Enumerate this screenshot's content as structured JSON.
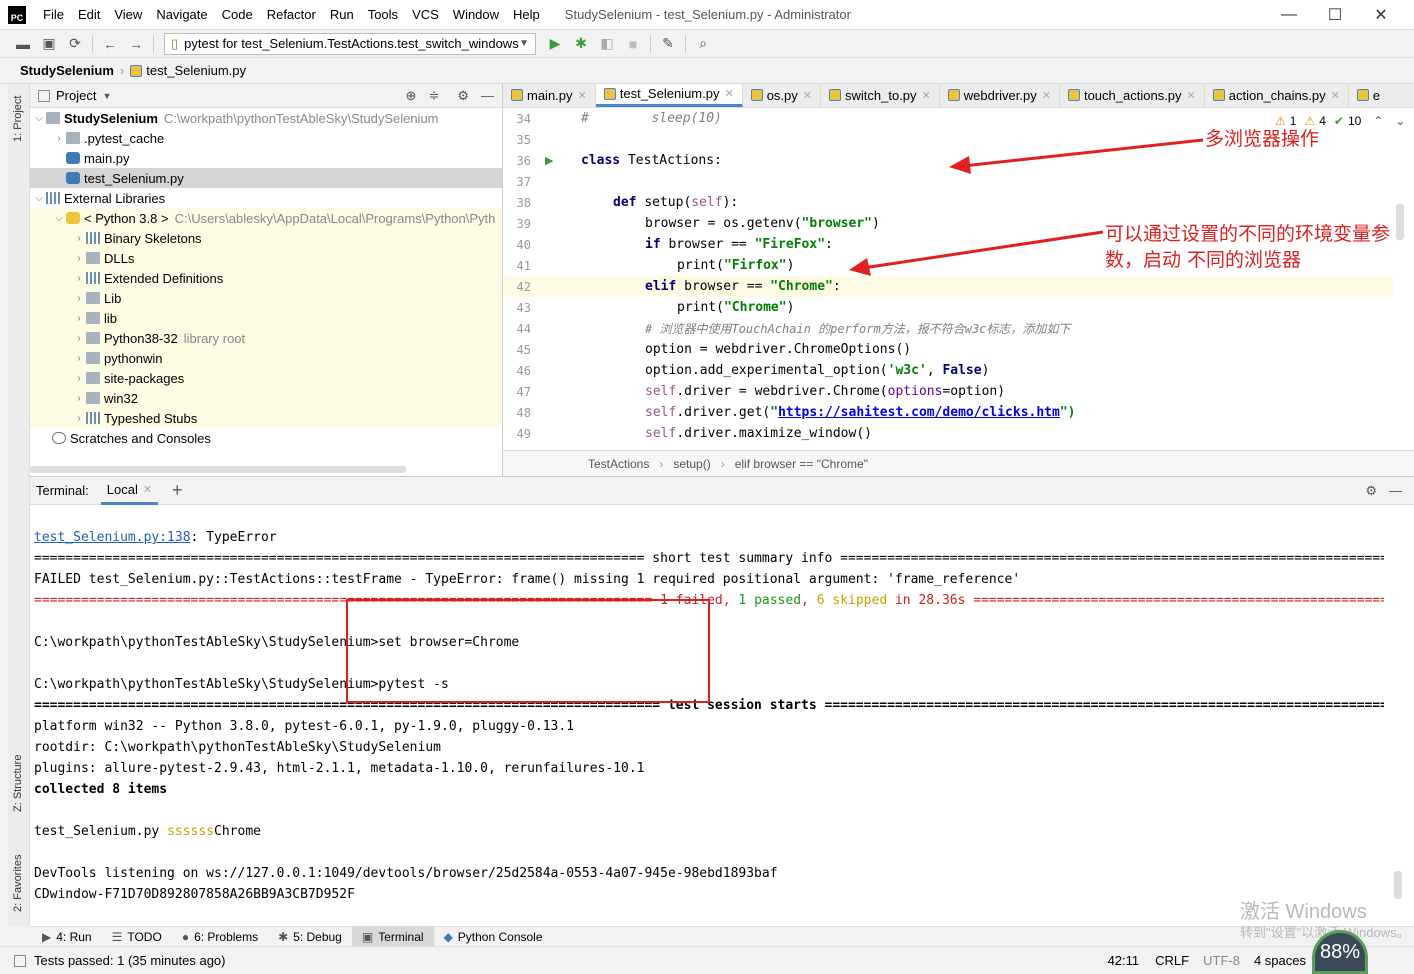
{
  "titlebar": {
    "menus": [
      "File",
      "Edit",
      "View",
      "Navigate",
      "Code",
      "Refactor",
      "Run",
      "Tools",
      "VCS",
      "Window",
      "Help"
    ],
    "window_title": "StudySelenium - test_Selenium.py - Administrator",
    "logo": "PC"
  },
  "toolbar": {
    "run_config": "pytest for test_Selenium.TestActions.test_switch_windows"
  },
  "breadcrumb": {
    "project": "StudySelenium",
    "file": "test_Selenium.py"
  },
  "left_strip": {
    "project_tab": "1: Project",
    "structure_tab": "Z: Structure",
    "favorites_tab": "2: Favorites"
  },
  "project": {
    "header": "Project",
    "tree": [
      {
        "label": "StudySelenium",
        "hint": "C:\\workpath\\pythonTestAbleSky\\StudySelenium"
      },
      {
        "label": ".pytest_cache",
        "hint": ""
      },
      {
        "label": "main.py",
        "hint": ""
      },
      {
        "label": "test_Selenium.py",
        "hint": ""
      },
      {
        "label": "External Libraries",
        "hint": ""
      },
      {
        "label": "< Python 3.8 >",
        "hint": "C:\\Users\\ablesky\\AppData\\Local\\Programs\\Python\\Pyth"
      },
      {
        "label": "Binary Skeletons",
        "hint": ""
      },
      {
        "label": "DLLs",
        "hint": ""
      },
      {
        "label": "Extended Definitions",
        "hint": ""
      },
      {
        "label": "Lib",
        "hint": ""
      },
      {
        "label": "lib",
        "hint": ""
      },
      {
        "label": "Python38-32",
        "hint": "library root"
      },
      {
        "label": "pythonwin",
        "hint": ""
      },
      {
        "label": "site-packages",
        "hint": ""
      },
      {
        "label": "win32",
        "hint": ""
      },
      {
        "label": "Typeshed Stubs",
        "hint": ""
      },
      {
        "label": "Scratches and Consoles",
        "hint": ""
      }
    ]
  },
  "editor": {
    "tabs": [
      "main.py",
      "test_Selenium.py",
      "os.py",
      "switch_to.py",
      "webdriver.py",
      "touch_actions.py",
      "action_chains.py",
      "e"
    ],
    "inspections": {
      "errors": "1",
      "warnings": "4",
      "weak": "10"
    },
    "line_numbers": [
      "34",
      "35",
      "36",
      "37",
      "38",
      "39",
      "40",
      "41",
      "42",
      "43",
      "44",
      "45",
      "46",
      "47",
      "48",
      "49"
    ],
    "lines": {
      "l34": "#        sleep(10)",
      "l36a": "class ",
      "l36b": "TestActions:",
      "l38a": "def ",
      "l38b": "setup(",
      "l38c": "self",
      "l38d": "):",
      "l39a": "browser = os.getenv(",
      "l39b": "\"browser\"",
      "l39c": ")",
      "l40a": "if ",
      "l40b": "browser == ",
      "l40c": "\"FireFox\"",
      "l40d": ":",
      "l41a": "print(",
      "l41b": "\"Firfox\"",
      "l41c": ")",
      "l42a": "elif ",
      "l42b": "browser == ",
      "l42c": "\"Chrome\"",
      "l42d": ":",
      "l43a": "print(",
      "l43b": "\"Chrome\"",
      "l43c": ")",
      "l44": "# 浏览器中使用TouchAchain 的perform方法，报不符合w3c标志，添加如下",
      "l45": "option = webdriver.ChromeOptions()",
      "l46a": "option.add_experimental_option(",
      "l46b": "'w3c'",
      "l46c": ", ",
      "l46d": "False",
      "l46e": ")",
      "l47a": "self",
      "l47b": ".driver = webdriver.Chrome(",
      "l47c": "options",
      "l47d": "=option)",
      "l48a": "self",
      "l48b": ".driver.get(",
      "l48c": "\"",
      "l48d": "https://sahitest.com/demo/clicks.htm",
      "l48e": "\")",
      "l49a": "self",
      "l49b": ".driver.maximize_window()"
    },
    "crumbs": [
      "TestActions",
      "setup()",
      "elif browser == \"Chrome\""
    ],
    "annotation1": "多浏览器操作",
    "annotation2_line1": "可以通过设置的不同的环境变量参",
    "annotation2_line2": "数，启动 不同的浏览器"
  },
  "terminal": {
    "label": "Terminal:",
    "tab": "Local",
    "lines": {
      "t1a": "test_Selenium.py:138",
      "t1b": ": TypeError",
      "t2": "============================================================================== short test summary info ==============================================================================",
      "t3": "FAILED test_Selenium.py::TestActions::testFrame - TypeError: frame() missing 1 required positional argument: 'frame_reference'",
      "t4a": "=============================================================================== ",
      "t4b": "1 failed",
      "t4c": ", ",
      "t4d": "1 passed",
      "t4e": ", ",
      "t4f": "6 skipped",
      "t4g": " in 28.36s ================================================================================",
      "t6": "C:\\workpath\\pythonTestAbleSky\\StudySelenium>set browser=Chrome",
      "t8": "C:\\workpath\\pythonTestAbleSky\\StudySelenium>pytest -s",
      "t9": "================================================================================ test session starts ================================================================================",
      "t10": "platform win32 -- Python 3.8.0, pytest-6.0.1, py-1.9.0, pluggy-0.13.1",
      "t11": "rootdir: C:\\workpath\\pythonTestAbleSky\\StudySelenium",
      "t12": "plugins: allure-pytest-2.9.43, html-2.1.1, metadata-1.10.0, rerunfailures-10.1",
      "t13": "collected 8 items",
      "t15a": "test_Selenium.py ",
      "t15b": "ssssss",
      "t15c": "Chrome",
      "t17": "DevTools listening on ws://127.0.0.1:1049/devtools/browser/25d2584a-0553-4a07-945e-98ebd1893baf",
      "t18": "CDwindow-F71D70D892807858A26BB9A3CB7D952F"
    }
  },
  "bottom_tabs": [
    "4: Run",
    "TODO",
    "6: Problems",
    "5: Debug",
    "Terminal",
    "Python Console"
  ],
  "status": {
    "message": "Tests passed: 1 (35 minutes ago)",
    "position": "42:11",
    "line_sep": "CRLF",
    "encoding": "UTF-8",
    "indent": "4 spaces",
    "gauge": "88%"
  },
  "watermark": {
    "line1": "激活 Windows",
    "line2": "转到\"设置\"以激活 Windows。"
  },
  "colors": {
    "annotation": "#e02020",
    "keyword": "#000080",
    "string": "#008000",
    "link": "#0000ee"
  }
}
